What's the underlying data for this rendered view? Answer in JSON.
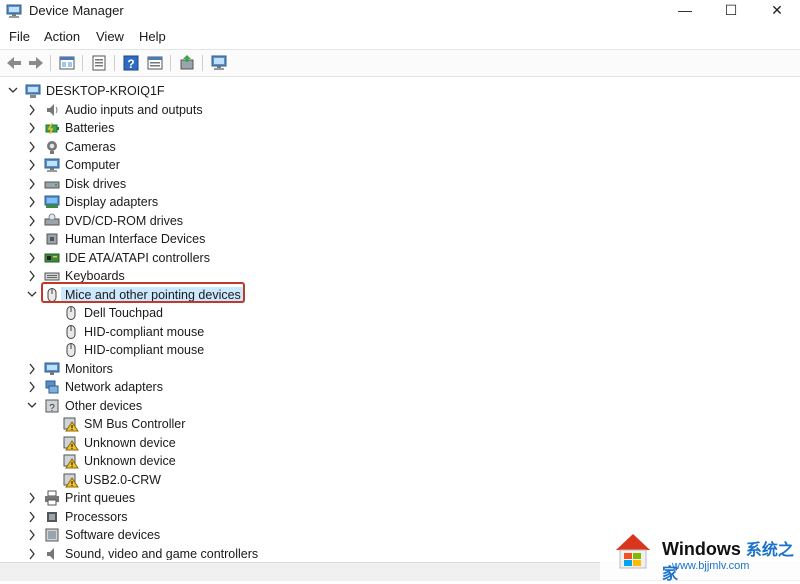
{
  "window": {
    "title": "Device Manager",
    "minimize_glyph": "—",
    "maximize_glyph": "☐",
    "close_glyph": "✕"
  },
  "menu": [
    "File",
    "Action",
    "View",
    "Help"
  ],
  "toolbar": [
    {
      "name": "back-icon"
    },
    {
      "name": "forward-icon"
    },
    {
      "name": "properties-icon"
    },
    {
      "name": "show-hidden-icon"
    },
    {
      "name": "help-icon"
    },
    {
      "name": "view-icon"
    },
    {
      "name": "update-driver-icon"
    },
    {
      "name": "scan-hardware-icon"
    }
  ],
  "tree": {
    "root": "DESKTOP-KROIQ1F",
    "items": [
      {
        "label": "Audio inputs and outputs",
        "icon": "speaker-icon",
        "state": "collapsed"
      },
      {
        "label": "Batteries",
        "icon": "battery-icon",
        "state": "collapsed"
      },
      {
        "label": "Cameras",
        "icon": "camera-icon",
        "state": "collapsed"
      },
      {
        "label": "Computer",
        "icon": "computer-icon",
        "state": "collapsed"
      },
      {
        "label": "Disk drives",
        "icon": "disk-drive-icon",
        "state": "collapsed"
      },
      {
        "label": "Display adapters",
        "icon": "display-adapter-icon",
        "state": "collapsed"
      },
      {
        "label": "DVD/CD-ROM drives",
        "icon": "dvd-drive-icon",
        "state": "collapsed"
      },
      {
        "label": "Human Interface Devices",
        "icon": "hid-icon",
        "state": "collapsed"
      },
      {
        "label": "IDE ATA/ATAPI controllers",
        "icon": "ide-controller-icon",
        "state": "collapsed"
      },
      {
        "label": "Keyboards",
        "icon": "keyboard-icon",
        "state": "collapsed"
      },
      {
        "label": "Mice and other pointing devices",
        "icon": "mouse-icon",
        "state": "expanded",
        "selected": true,
        "children": [
          {
            "label": "Dell Touchpad",
            "icon": "mouse-icon"
          },
          {
            "label": "HID-compliant mouse",
            "icon": "mouse-icon"
          },
          {
            "label": "HID-compliant mouse",
            "icon": "mouse-icon"
          }
        ]
      },
      {
        "label": "Monitors",
        "icon": "monitor-icon",
        "state": "collapsed"
      },
      {
        "label": "Network adapters",
        "icon": "network-adapter-icon",
        "state": "collapsed"
      },
      {
        "label": "Other devices",
        "icon": "other-devices-icon",
        "state": "expanded",
        "children": [
          {
            "label": "SM Bus Controller",
            "icon": "warning-device-icon"
          },
          {
            "label": "Unknown device",
            "icon": "warning-device-icon"
          },
          {
            "label": "Unknown device",
            "icon": "warning-device-icon"
          },
          {
            "label": "USB2.0-CRW",
            "icon": "warning-device-icon"
          }
        ]
      },
      {
        "label": "Print queues",
        "icon": "printer-icon",
        "state": "collapsed"
      },
      {
        "label": "Processors",
        "icon": "processor-icon",
        "state": "collapsed"
      },
      {
        "label": "Software devices",
        "icon": "software-device-icon",
        "state": "collapsed"
      },
      {
        "label": "Sound, video and game controllers",
        "icon": "sound-controller-icon",
        "state": "collapsed"
      }
    ]
  },
  "watermark": {
    "title": "Windows",
    "title_cn": "系统之家",
    "url": "www.bjjmlv.com"
  }
}
